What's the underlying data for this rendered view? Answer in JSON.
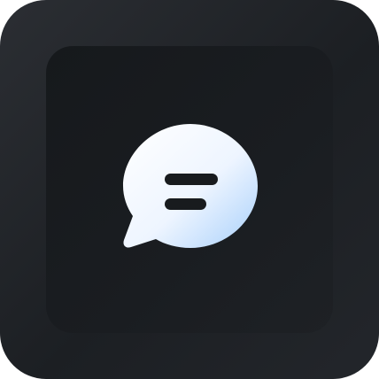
{
  "app_icon": {
    "icon": "chat-bubble-icon",
    "colors": {
      "outer_tile": "#23262a",
      "inner_tile": "#181b1e",
      "bubble_light": "#ffffff",
      "bubble_blue": "#a8d0fb",
      "text_lines": "#181b1e"
    }
  }
}
